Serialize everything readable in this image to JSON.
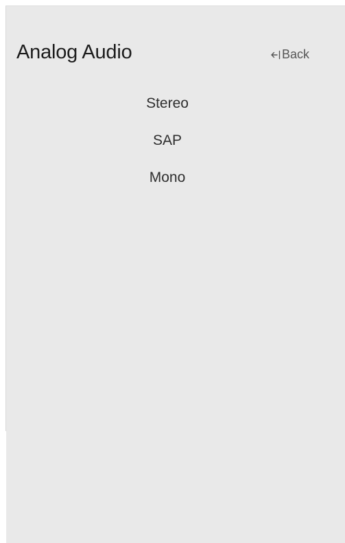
{
  "header": {
    "title": "Analog Audio",
    "back_label": "Back"
  },
  "options": [
    {
      "label": "Stereo"
    },
    {
      "label": "SAP"
    },
    {
      "label": "Mono"
    }
  ],
  "icons": {
    "back": "back-arrow-icon"
  },
  "colors": {
    "background": "#e9e9e9",
    "text": "#1c1c1c"
  }
}
